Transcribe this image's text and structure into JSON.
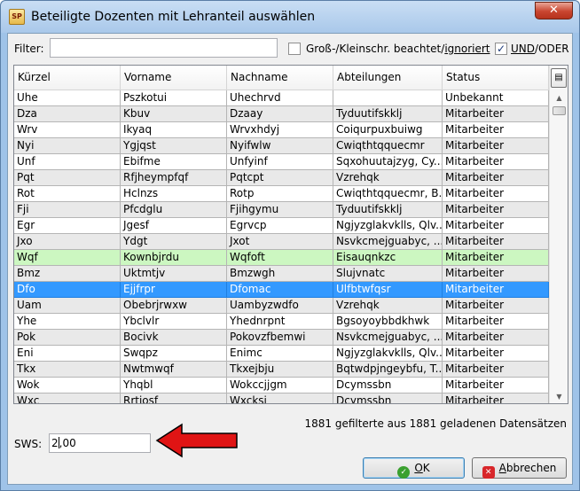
{
  "window": {
    "title": "Beteiligte Dozenten mit Lehranteil auswählen",
    "app_icon": "SP",
    "close_glyph": "✕"
  },
  "filter": {
    "label": "Filter:",
    "value": "",
    "case_checked": false,
    "case_label_prefix": "Groß-/Kleinschr. beachtet/",
    "case_label_suffix": "ignoriert",
    "andor_checked": true,
    "andor_and": "UND",
    "andor_or": "/ODER"
  },
  "table": {
    "columns": [
      "Kürzel",
      "Vorname",
      "Nachname",
      "Abteilungen",
      "Status"
    ],
    "rows": [
      {
        "k": "Uhe",
        "v": "Pszkotui",
        "n": "Uhechrvd",
        "a": "",
        "s": "Unbekannt"
      },
      {
        "k": "Dza",
        "v": "Kbuv",
        "n": "Dzaay",
        "a": "Tyduutifskklj",
        "s": "Mitarbeiter"
      },
      {
        "k": "Wrv",
        "v": "Ikyaq",
        "n": "Wrvxhdyj",
        "a": "Coiqurpuxbuiwg",
        "s": "Mitarbeiter"
      },
      {
        "k": "Nyi",
        "v": "Ygjqst",
        "n": "Nyifwlw",
        "a": "Cwiqthtqquecmr",
        "s": "Mitarbeiter"
      },
      {
        "k": "Unf",
        "v": "Ebifme",
        "n": "Unfyinf",
        "a": "Sqxohuutajzyg, Cy...",
        "s": "Mitarbeiter"
      },
      {
        "k": "Pqt",
        "v": "Rfjheympfqf",
        "n": "Pqtcpt",
        "a": "Vzrehqk",
        "s": "Mitarbeiter"
      },
      {
        "k": "Rot",
        "v": "Hclnzs",
        "n": "Rotp",
        "a": "Cwiqthtqquecmr, B...",
        "s": "Mitarbeiter"
      },
      {
        "k": "Fji",
        "v": "Pfcdglu",
        "n": "Fjihgymu",
        "a": "Tyduutifskklj",
        "s": "Mitarbeiter"
      },
      {
        "k": "Egr",
        "v": "Jgesf",
        "n": "Egrvcp",
        "a": "Ngjyzglakvklls, Qlv...",
        "s": "Mitarbeiter"
      },
      {
        "k": "Jxo",
        "v": "Ydgt",
        "n": "Jxot",
        "a": "Nsvkcmejguabyc, ...",
        "s": "Mitarbeiter"
      },
      {
        "k": "Wqf",
        "v": "Kownbjrdu",
        "n": "Wqfoft",
        "a": "Eisauqnkzc",
        "s": "Mitarbeiter"
      },
      {
        "k": "Bmz",
        "v": "Uktmtjv",
        "n": "Bmzwgh",
        "a": "Slujvnatc",
        "s": "Mitarbeiter"
      },
      {
        "k": "Dfo",
        "v": "Ejjfrpr",
        "n": "Dfomac",
        "a": "Ulfbtwfqsr",
        "s": "Mitarbeiter"
      },
      {
        "k": "Uam",
        "v": "Obebrjrwxw",
        "n": "Uambyzwdfo",
        "a": "Vzrehqk",
        "s": "Mitarbeiter"
      },
      {
        "k": "Yhe",
        "v": "Ybclvlr",
        "n": "Yhednrpnt",
        "a": "Bgsoyoybbdkhwk",
        "s": "Mitarbeiter"
      },
      {
        "k": "Pok",
        "v": "Bocivk",
        "n": "Pokovzfbemwi",
        "a": "Nsvkcmejguabyc, ...",
        "s": "Mitarbeiter"
      },
      {
        "k": "Eni",
        "v": "Swqpz",
        "n": "Enimc",
        "a": "Ngjyzglakvklls, Qlv...",
        "s": "Mitarbeiter"
      },
      {
        "k": "Tkx",
        "v": "Nwtmwqf",
        "n": "Tkxejbju",
        "a": "Bqtwdpjngeybfu, T...",
        "s": "Mitarbeiter"
      },
      {
        "k": "Wok",
        "v": "Yhqbl",
        "n": "Wokccjjgm",
        "a": "Dcymssbn",
        "s": "Mitarbeiter"
      },
      {
        "k": "Wxc",
        "v": "Rrtjosf",
        "n": "Wxcksj",
        "a": "Dcymssbn",
        "s": "Mitarbeiter"
      }
    ],
    "highlighted_row": 10,
    "selected_row": 12,
    "scroll": {
      "up_glyph": "▲",
      "down_glyph": "▼",
      "chooser_glyph": "▤"
    }
  },
  "status_text": "1881 gefilterte aus 1881 geladenen Datensätzen",
  "sws": {
    "label": "SWS:",
    "before_caret": "2",
    "after_caret": ",00"
  },
  "annotation": {
    "arrow_color": "#e01414"
  },
  "buttons": {
    "ok_underlined": "O",
    "ok_rest": "K",
    "cancel_underlined": "A",
    "cancel_rest": "bbrechen",
    "ok_icon_glyph": "✓",
    "cancel_icon_glyph": "✕"
  }
}
